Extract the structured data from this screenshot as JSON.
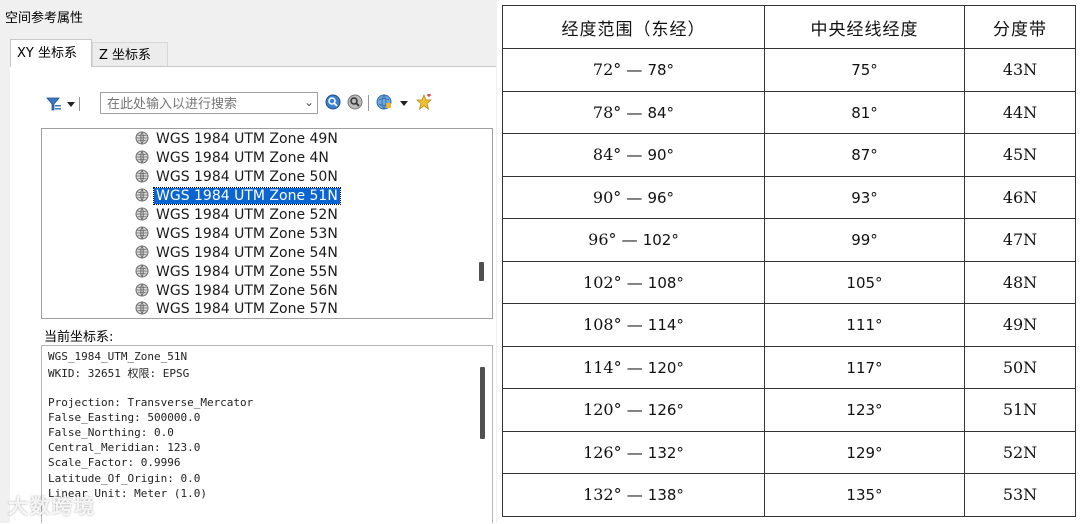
{
  "dialog": {
    "title": "空间参考属性",
    "tabs": [
      "XY 坐标系",
      "Z 坐标系"
    ],
    "search_placeholder": "在此处输入以进行搜索",
    "tree_items": [
      {
        "label": "WGS 1984 UTM Zone 49N",
        "selected": false
      },
      {
        "label": "WGS 1984 UTM Zone 4N",
        "selected": false
      },
      {
        "label": "WGS 1984 UTM Zone 50N",
        "selected": false
      },
      {
        "label": "WGS 1984 UTM Zone 51N",
        "selected": true
      },
      {
        "label": "WGS 1984 UTM Zone 52N",
        "selected": false
      },
      {
        "label": "WGS 1984 UTM Zone 53N",
        "selected": false
      },
      {
        "label": "WGS 1984 UTM Zone 54N",
        "selected": false
      },
      {
        "label": "WGS 1984 UTM Zone 55N",
        "selected": false
      },
      {
        "label": "WGS 1984 UTM Zone 56N",
        "selected": false
      },
      {
        "label": "WGS 1984 UTM Zone 57N",
        "selected": false
      }
    ],
    "current_label": "当前坐标系:",
    "info_lines": [
      "WGS_1984_UTM_Zone_51N",
      "WKID: 32651 权限: EPSG",
      "",
      "Projection: Transverse_Mercator",
      "False_Easting: 500000.0",
      "False_Northing: 0.0",
      "Central_Meridian: 123.0",
      "Scale_Factor: 0.9996",
      "Latitude_Of_Origin: 0.0",
      "Linear Unit: Meter (1.0)"
    ],
    "watermark": "大数跨境",
    "accent_color": "#0a64d2"
  },
  "table": {
    "headers": [
      "经度范围（东经）",
      "中央经线经度",
      "分度带"
    ],
    "rows": [
      {
        "from": "72°",
        "to": "78°",
        "central": "75°",
        "zone": "43N"
      },
      {
        "from": "78°",
        "to": "84°",
        "central": "81°",
        "zone": "44N"
      },
      {
        "from": "84°",
        "to": "90°",
        "central": "87°",
        "zone": "45N"
      },
      {
        "from": "90°",
        "to": "96°",
        "central": "93°",
        "zone": "46N"
      },
      {
        "from": "96°",
        "to": "102°",
        "central": "99°",
        "zone": "47N"
      },
      {
        "from": "102°",
        "to": "108°",
        "central": "105°",
        "zone": "48N"
      },
      {
        "from": "108°",
        "to": "114°",
        "central": "111°",
        "zone": "49N"
      },
      {
        "from": "114°",
        "to": "120°",
        "central": "117°",
        "zone": "50N"
      },
      {
        "from": "120°",
        "to": "126°",
        "central": "123°",
        "zone": "51N"
      },
      {
        "from": "126°",
        "to": "132°",
        "central": "129°",
        "zone": "52N"
      },
      {
        "from": "132°",
        "to": "138°",
        "central": "135°",
        "zone": "53N"
      }
    ],
    "range_separator": "—"
  }
}
